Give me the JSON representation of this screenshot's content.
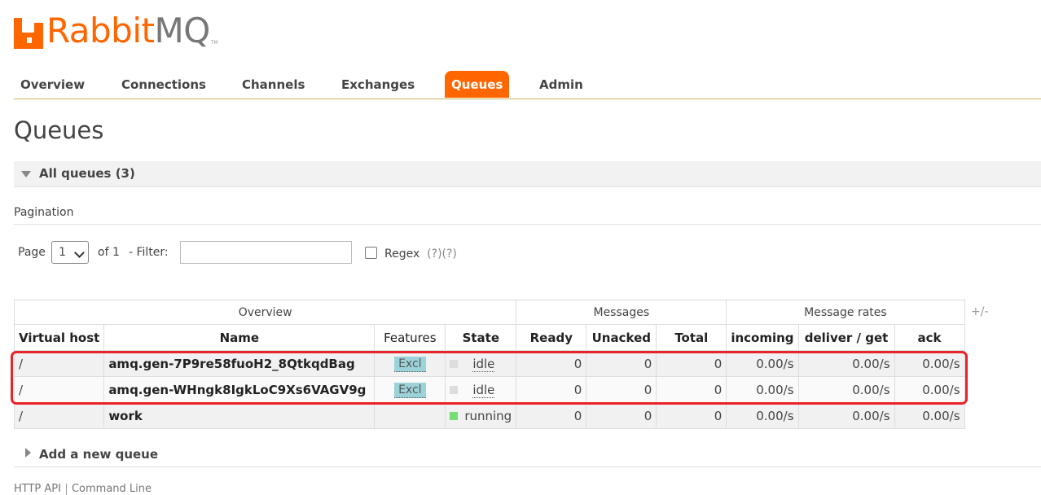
{
  "brand": {
    "name_part1": "Rabbit",
    "name_part2": "MQ",
    "trademark": "TM",
    "accent": "#ff6600"
  },
  "nav": {
    "tabs": [
      {
        "label": "Overview"
      },
      {
        "label": "Connections"
      },
      {
        "label": "Channels"
      },
      {
        "label": "Exchanges"
      },
      {
        "label": "Queues",
        "active": true
      },
      {
        "label": "Admin"
      }
    ]
  },
  "page": {
    "title": "Queues"
  },
  "section": {
    "header": "All queues (3)"
  },
  "pagination": {
    "title": "Pagination",
    "page_label": "Page",
    "page_value": "1",
    "of_label": "of 1",
    "filter_label": "- Filter:",
    "filter_value": "",
    "regex_label": "Regex",
    "regex_checked": false,
    "help1": "(?)",
    "help2": "(?)"
  },
  "table": {
    "groups": [
      "Overview",
      "Messages",
      "Message rates"
    ],
    "plus_minus": "+/-",
    "columns": [
      "Virtual host",
      "Name",
      "Features",
      "State",
      "Ready",
      "Unacked",
      "Total",
      "incoming",
      "deliver / get",
      "ack"
    ],
    "rows": [
      {
        "vhost": "/",
        "name": "amq.gen-7P9re58fuoH2_8QtkqdBag",
        "feature": "Excl",
        "state": "idle",
        "state_color": "#dddddd",
        "ready": "0",
        "unacked": "0",
        "total": "0",
        "incoming": "0.00/s",
        "deliver_get": "0.00/s",
        "ack": "0.00/s"
      },
      {
        "vhost": "/",
        "name": "amq.gen-WHngk8IgkLoC9Xs6VAGV9g",
        "feature": "Excl",
        "state": "idle",
        "state_color": "#dddddd",
        "ready": "0",
        "unacked": "0",
        "total": "0",
        "incoming": "0.00/s",
        "deliver_get": "0.00/s",
        "ack": "0.00/s"
      },
      {
        "vhost": "/",
        "name": "work",
        "feature": "",
        "state": "running",
        "state_color": "#77dd77",
        "ready": "0",
        "unacked": "0",
        "total": "0",
        "incoming": "0.00/s",
        "deliver_get": "0.00/s",
        "ack": "0.00/s"
      }
    ]
  },
  "add_queue": {
    "label": "Add a new queue"
  },
  "footer": {
    "links": [
      "HTTP API",
      "Command Line"
    ]
  }
}
